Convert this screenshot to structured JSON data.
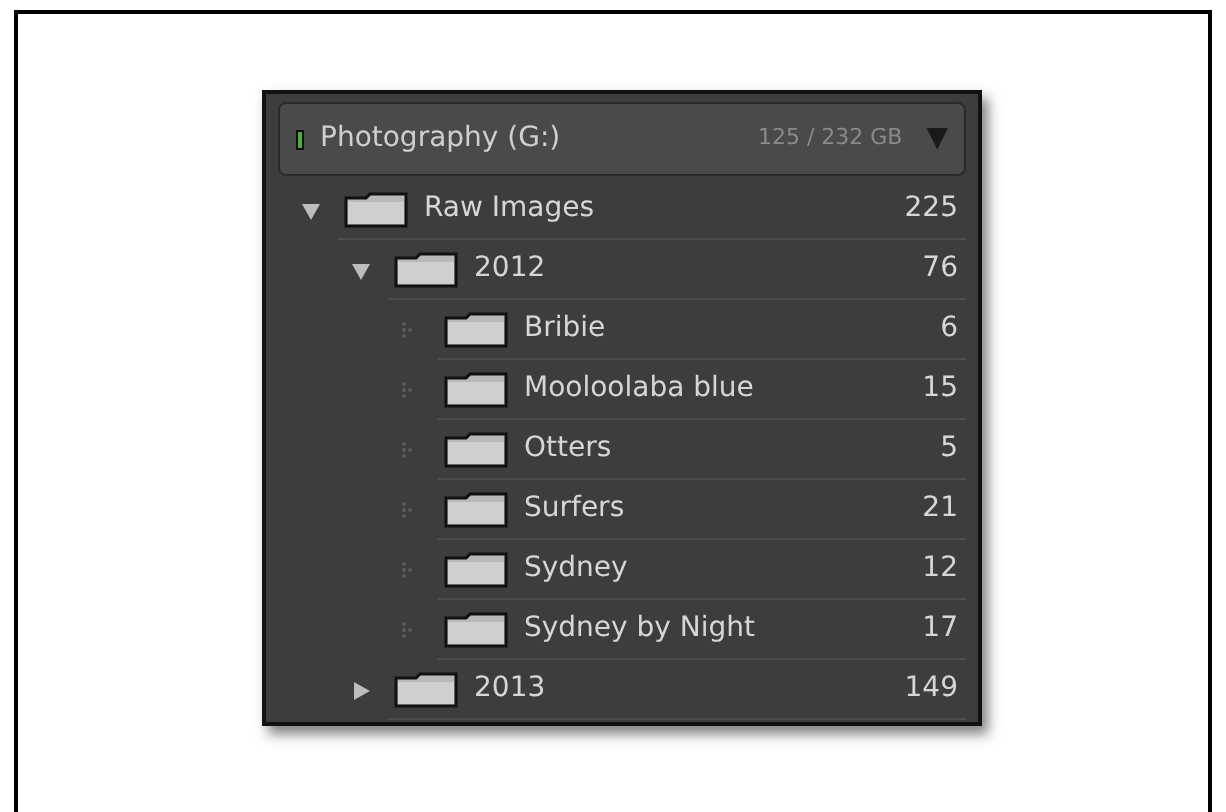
{
  "volume": {
    "name": "Photography (G:)",
    "usage": "125 / 232 GB",
    "toggle": "▼"
  },
  "folders": [
    {
      "kind": "group",
      "name": "Raw Images",
      "count": "225",
      "expanded": true,
      "children": [
        {
          "kind": "group",
          "name": "2012",
          "count": "76",
          "expanded": true,
          "children": [
            {
              "kind": "leaf",
              "name": "Bribie",
              "count": "6"
            },
            {
              "kind": "leaf",
              "name": "Mooloolaba blue",
              "count": "15"
            },
            {
              "kind": "leaf",
              "name": "Otters",
              "count": "5"
            },
            {
              "kind": "leaf",
              "name": "Surfers",
              "count": "21"
            },
            {
              "kind": "leaf",
              "name": "Sydney",
              "count": "12"
            },
            {
              "kind": "leaf",
              "name": "Sydney by Night",
              "count": "17"
            }
          ]
        },
        {
          "kind": "group",
          "name": "2013",
          "count": "149",
          "expanded": false
        }
      ]
    }
  ]
}
